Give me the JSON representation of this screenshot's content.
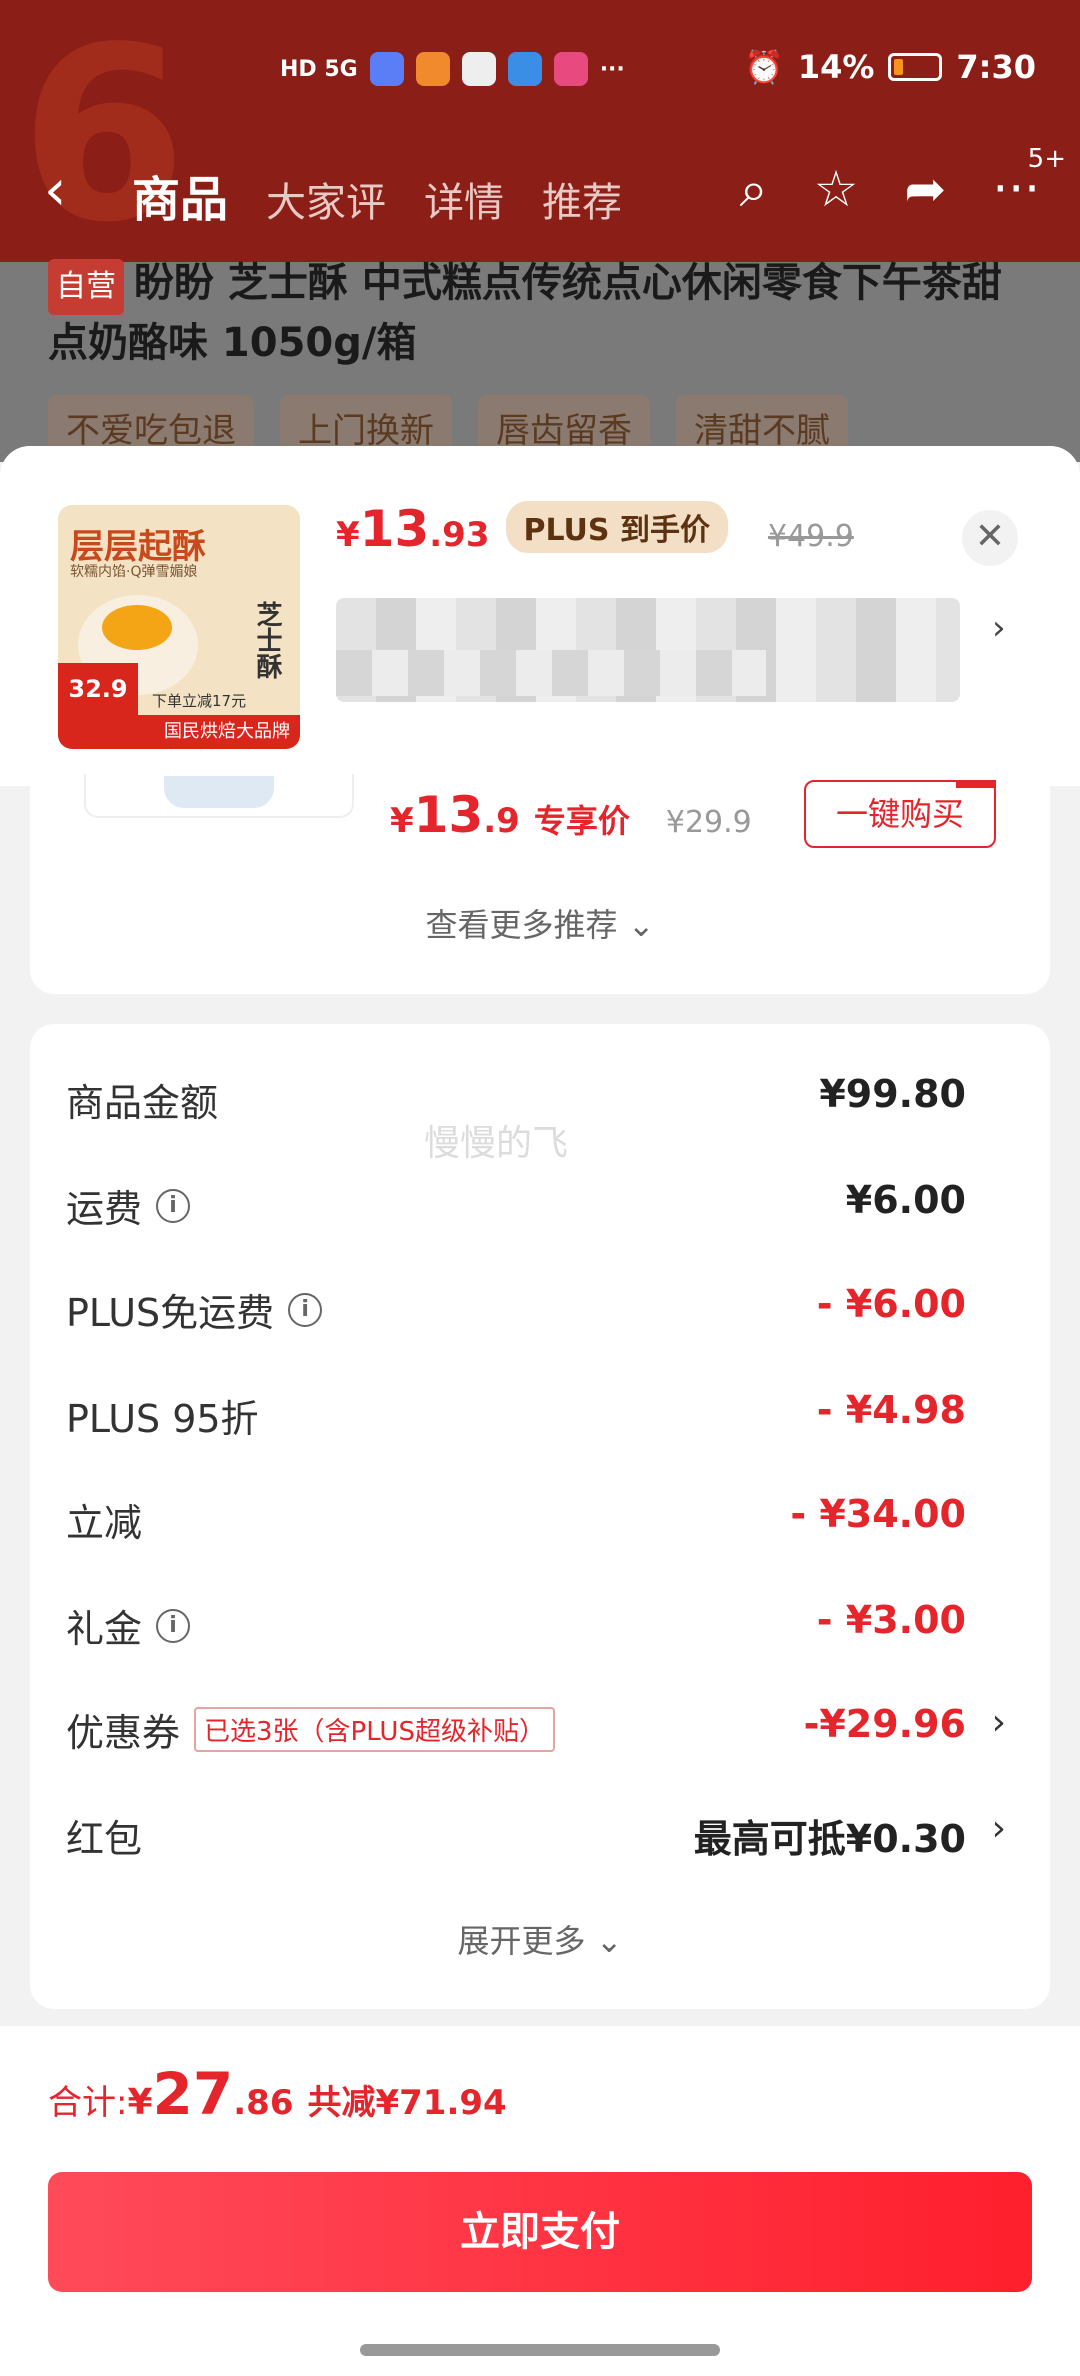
{
  "status_bar": {
    "network": "HD 5G",
    "battery": "14%",
    "time": "7:30"
  },
  "nav": {
    "tabs": [
      "商品",
      "大家评",
      "详情",
      "推荐"
    ],
    "badge": "5+"
  },
  "product": {
    "self_tag": "自营",
    "title": "盼盼 芝士酥 中式糕点传统点心休闲零食下午茶甜点奶酪味 1050g/箱",
    "tags": [
      "不爱吃包退",
      "上门换新",
      "唇齿留香",
      "清甜不腻"
    ]
  },
  "sku_sheet": {
    "thumb": {
      "line1": "层层起酥",
      "line2": "软糯内馅·Q弹雪媚娘",
      "side": "芝士酥",
      "price": "32.9",
      "promo": "下单立减17元",
      "footer": "国民烘焙大品牌"
    },
    "price_symbol": "¥",
    "price_int": "13",
    "price_dec": ".93",
    "plus_badge": "PLUS 到手价",
    "original_price": "¥49.9"
  },
  "recommend": {
    "price_symbol": "¥",
    "price_int": "13",
    "price_dec": ".9",
    "tag": "专享价",
    "original": "¥29.9",
    "buy_label": "一键购买",
    "more_label": "查看更多推荐"
  },
  "fees": [
    {
      "label": "商品金额",
      "value": "¥99.80",
      "red": false,
      "info": false
    },
    {
      "label": "运费",
      "value": "¥6.00",
      "red": false,
      "info": true
    },
    {
      "label": "PLUS免运费",
      "value": "- ¥6.00",
      "red": true,
      "info": true
    },
    {
      "label": "PLUS 95折",
      "value": "- ¥4.98",
      "red": true,
      "info": false
    },
    {
      "label": "立减",
      "value": "- ¥34.00",
      "red": true,
      "info": false
    },
    {
      "label": "礼金",
      "value": "- ¥3.00",
      "red": true,
      "info": true
    }
  ],
  "coupon": {
    "label": "优惠券",
    "selected": "已选3张（含PLUS超级补贴）",
    "value": "-¥29.96"
  },
  "redpacket": {
    "label": "红包",
    "value": "最高可抵¥0.30"
  },
  "watermark": "慢慢的飞",
  "expand_label": "展开更多",
  "total": {
    "label": "合计:",
    "symbol": "¥",
    "int": "27",
    "dec": ".86",
    "saved": "共减¥71.94"
  },
  "pay_button": "立即支付",
  "colors": {
    "accent": "#e4252c",
    "header": "#8b1e16",
    "plus_badge_bg": "#f2dfc6"
  }
}
